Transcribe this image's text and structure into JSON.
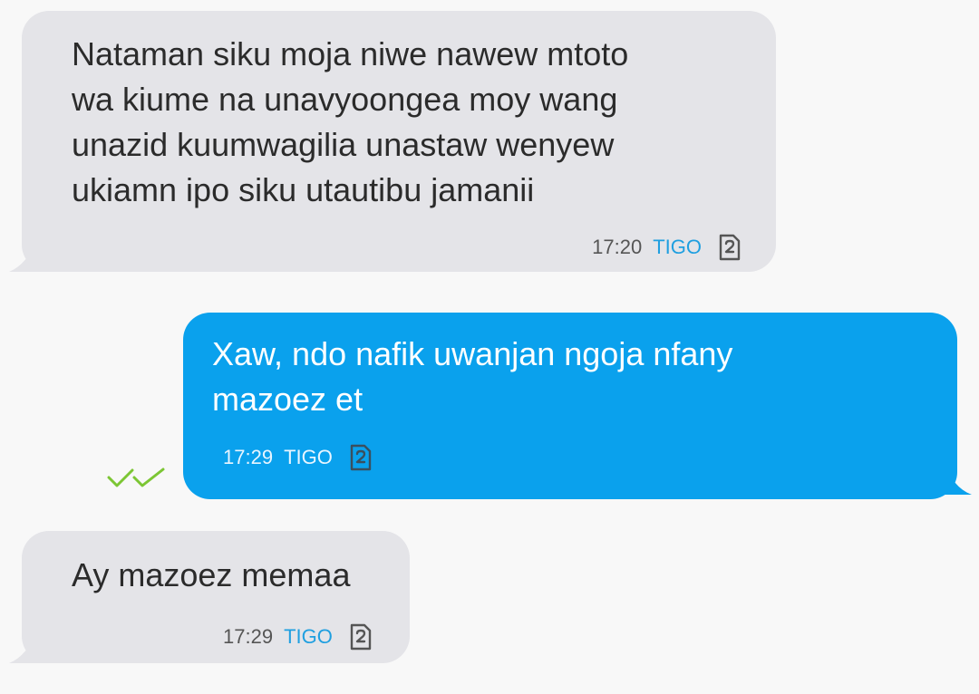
{
  "conversation": {
    "messages": [
      {
        "direction": "incoming",
        "text": "Nataman siku moja niwe nawew mtoto\nwa kiume na unavyoongea moy wang\nunazid kuumwagilia unastaw wenyew\nukiamn ipo siku utautibu jamanii",
        "time": "17:20",
        "carrier": "TIGO",
        "sim_icon": "sim-2-icon"
      },
      {
        "direction": "outgoing",
        "text": "Xaw, ndo nafik uwanjan ngoja nfany\nmazoez et",
        "time": "17:29",
        "carrier": "TIGO",
        "sim_icon": "sim-2-icon",
        "status": "delivered",
        "status_icon": "double-check-icon"
      },
      {
        "direction": "incoming",
        "text": "Ay mazoez memaa",
        "time": "17:29",
        "carrier": "TIGO",
        "sim_icon": "sim-2-icon"
      }
    ]
  },
  "colors": {
    "background": "#f8f8f8",
    "incoming_bubble": "#e4e4e8",
    "outgoing_bubble": "#0aa1ed",
    "carrier_label_incoming": "#1f9fe0",
    "delivered_ticks": "#7cc634"
  }
}
